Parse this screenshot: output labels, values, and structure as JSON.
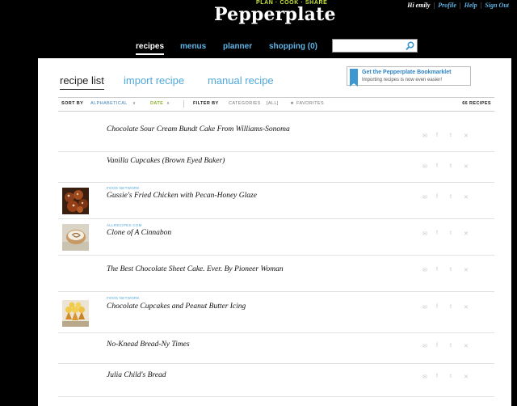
{
  "header": {
    "tagline": "PLAN · COOK · SHARE",
    "logo": "Pepperplate",
    "greeting": "Hi emily",
    "links": [
      "Profile",
      "Help",
      "Sign Out"
    ]
  },
  "nav": {
    "items": [
      "recipes",
      "menus",
      "planner",
      "shopping (0)"
    ],
    "active": "recipes"
  },
  "search": {
    "placeholder": "",
    "value": ""
  },
  "tabs": [
    "recipe list",
    "import recipe",
    "manual recipe"
  ],
  "bookmarklet": {
    "title": "Get the Pepperplate Bookmarklet",
    "subtitle": "Importing recipes is now even easier!"
  },
  "sortbar": {
    "sort_by_label": "SORT BY",
    "alphabetical": "ALPHABETICAL",
    "date": "DATE",
    "filter_by_label": "FILTER BY",
    "categories": "CATEGORIES",
    "categories_value": "[ALL]",
    "favorites": "FAVORITES",
    "count": "66 RECIPES"
  },
  "recipes": [
    {
      "title": "Chocolate Sour Cream Bundt Cake From Williams-Sonoma",
      "source": "",
      "thumb": ""
    },
    {
      "title": "Vanilla Cupcakes (Brown Eyed Baker)",
      "source": "",
      "thumb": ""
    },
    {
      "title": "Gussie's Fried Chicken with Pecan-Honey Glaze",
      "source": "FOOD NETWORK",
      "thumb": "fried-chicken"
    },
    {
      "title": "Clone of A Cinnabon",
      "source": "ALLRECIPES.COM",
      "thumb": "cinnamon-roll"
    },
    {
      "title": "The Best Chocolate Sheet Cake. Ever. By Pioneer Woman",
      "source": "",
      "thumb": ""
    },
    {
      "title": "Chocolate Cupcakes and Peanut Butter Icing",
      "source": "FOOD NETWORK",
      "thumb": "cupcakes"
    },
    {
      "title": "No-Knead Bread-Ny Times",
      "source": "",
      "thumb": ""
    },
    {
      "title": "Julia Child's Bread",
      "source": "",
      "thumb": ""
    }
  ],
  "row_actions": [
    "email-icon",
    "facebook-icon",
    "twitter-icon",
    "delete-icon"
  ],
  "colors": {
    "accent": "#5fb4e6",
    "green": "#8cb12a",
    "background": "#000000"
  }
}
